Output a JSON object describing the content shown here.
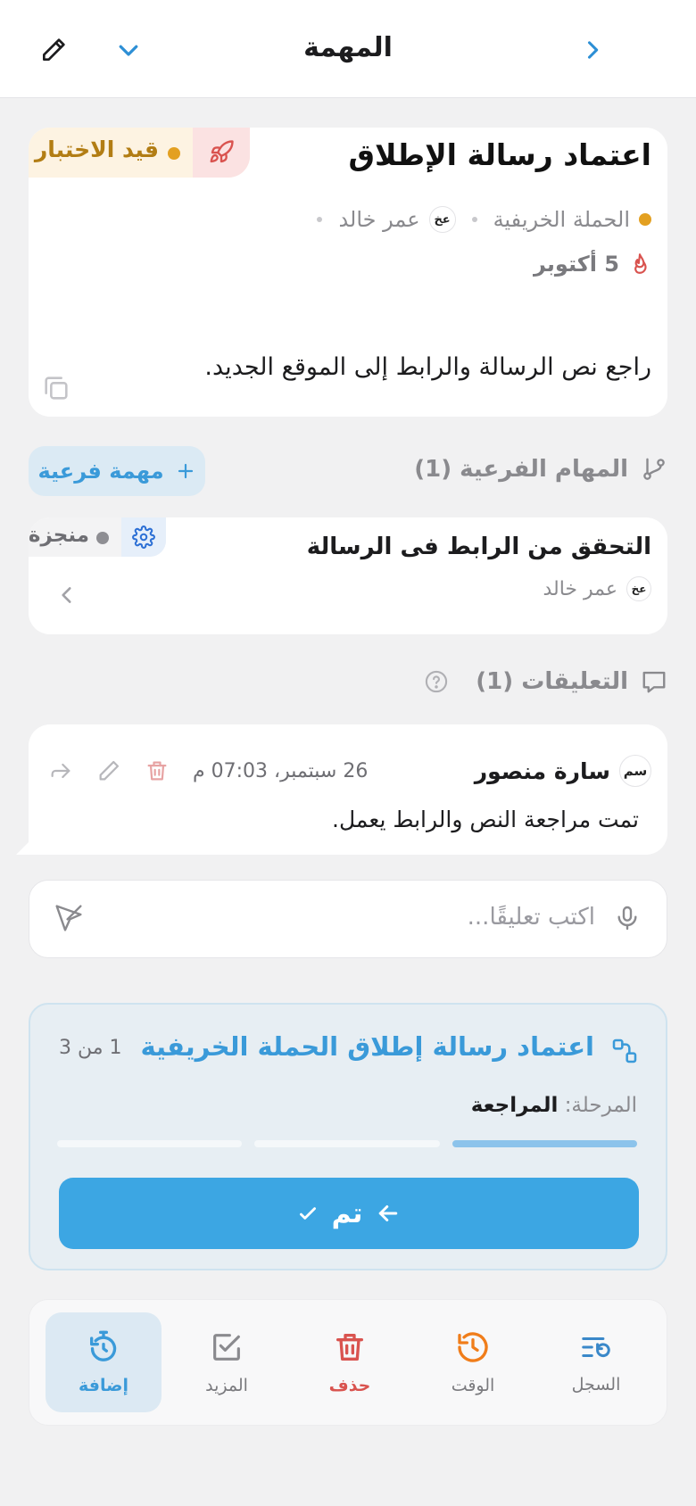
{
  "header": {
    "title": "المهمة"
  },
  "task": {
    "title": "اعتماد رسالة الإطلاق",
    "status": "قيد الاختبار",
    "project": "الحملة الخريفية",
    "assignee_initials": "عخ",
    "assignee_name": "عمر خالد",
    "due_date": "5 أكتوبر",
    "description": "راجع نص الرسالة والرابط إلى الموقع الجديد."
  },
  "subtasks": {
    "heading": "المهام الفرعية (1)",
    "add_label": "مهمة فرعية",
    "items": [
      {
        "title": "التحقق من الرابط فى الرسالة",
        "status": "منجزة",
        "assignee_initials": "عخ",
        "assignee_name": "عمر خالد"
      }
    ]
  },
  "comments": {
    "heading": "التعليقات (1)",
    "items": [
      {
        "author_initials": "سم",
        "author": "سارة منصور",
        "timestamp": "26 سبتمبر، 07:03 م",
        "text": "تمت مراجعة النص والرابط يعمل."
      }
    ],
    "input_placeholder": "اكتب تعليقًا..."
  },
  "workflow": {
    "title": "اعتماد رسالة إطلاق الحملة الخريفية",
    "step_counter": "1 من 3",
    "stage_label": "المرحلة:",
    "stage_value": "المراجعة",
    "steps_total": 3,
    "steps_done": 1,
    "done_label": "تم"
  },
  "toolbar": {
    "items": [
      {
        "label": "السجل",
        "icon": "log-list-icon"
      },
      {
        "label": "الوقت",
        "icon": "history-clock-icon"
      },
      {
        "label": "حذف",
        "icon": "trash-icon"
      },
      {
        "label": "المزيد",
        "icon": "checkbox-icon"
      },
      {
        "label": "إضافة",
        "icon": "timer-add-icon"
      }
    ]
  },
  "colors": {
    "accent": "#3ca6e3",
    "status_testing": "#e3a021",
    "danger": "#d9534f",
    "warning": "#f07d1a"
  }
}
